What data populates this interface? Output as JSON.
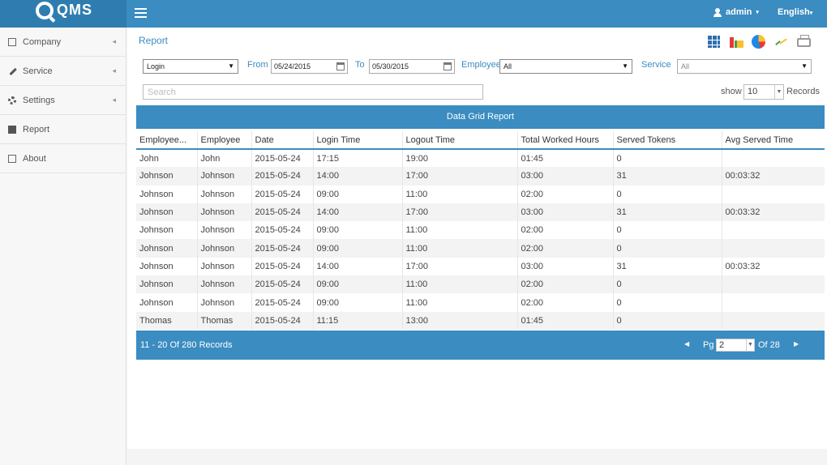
{
  "app": {
    "logo_text": "QMS"
  },
  "topbar": {
    "user": "admin",
    "language": "English"
  },
  "sidebar": {
    "items": [
      {
        "label": "Company",
        "icon": "building-icon",
        "has_submenu": true
      },
      {
        "label": "Service",
        "icon": "wrench-icon",
        "has_submenu": true
      },
      {
        "label": "Settings",
        "icon": "gear-icon",
        "has_submenu": true
      },
      {
        "label": "Report",
        "icon": "file-icon",
        "has_submenu": false
      },
      {
        "label": "About",
        "icon": "edit-icon",
        "has_submenu": false
      }
    ]
  },
  "page": {
    "title": "Report"
  },
  "toolbar": {
    "icons": [
      "grid-view-icon",
      "bar-chart-icon",
      "pie-chart-icon",
      "line-chart-icon",
      "printer-icon"
    ]
  },
  "filters": {
    "report_type": "Login",
    "from_label": "From",
    "from_date": "05/24/2015",
    "to_label": "To",
    "to_date": "05/30/2015",
    "employee_label": "Employee",
    "employee_value": "All",
    "service_label": "Service",
    "service_value": "All"
  },
  "search": {
    "placeholder": "Search"
  },
  "paging_size": {
    "show_label": "show",
    "value": "10",
    "records_label": "Records"
  },
  "grid": {
    "title": "Data Grid Report",
    "columns": [
      "Employee...",
      "Employee",
      "Date",
      "Login Time",
      "Logout Time",
      "Total Worked Hours",
      "Served Tokens",
      "Avg Served Time"
    ],
    "rows": [
      [
        "John",
        "John",
        "2015-05-24",
        "17:15",
        "19:00",
        "01:45",
        "0",
        ""
      ],
      [
        "Johnson",
        "Johnson",
        "2015-05-24",
        "14:00",
        "17:00",
        "03:00",
        "31",
        "00:03:32"
      ],
      [
        "Johnson",
        "Johnson",
        "2015-05-24",
        "09:00",
        "11:00",
        "02:00",
        "0",
        ""
      ],
      [
        "Johnson",
        "Johnson",
        "2015-05-24",
        "14:00",
        "17:00",
        "03:00",
        "31",
        "00:03:32"
      ],
      [
        "Johnson",
        "Johnson",
        "2015-05-24",
        "09:00",
        "11:00",
        "02:00",
        "0",
        ""
      ],
      [
        "Johnson",
        "Johnson",
        "2015-05-24",
        "09:00",
        "11:00",
        "02:00",
        "0",
        ""
      ],
      [
        "Johnson",
        "Johnson",
        "2015-05-24",
        "14:00",
        "17:00",
        "03:00",
        "31",
        "00:03:32"
      ],
      [
        "Johnson",
        "Johnson",
        "2015-05-24",
        "09:00",
        "11:00",
        "02:00",
        "0",
        ""
      ],
      [
        "Johnson",
        "Johnson",
        "2015-05-24",
        "09:00",
        "11:00",
        "02:00",
        "0",
        ""
      ],
      [
        "Thomas",
        "Thomas",
        "2015-05-24",
        "11:15",
        "13:00",
        "01:45",
        "0",
        ""
      ]
    ]
  },
  "footer": {
    "record_summary": "11 - 20 Of 280 Records",
    "page_label": "Pg",
    "page_value": "2",
    "page_of": "Of 28"
  }
}
